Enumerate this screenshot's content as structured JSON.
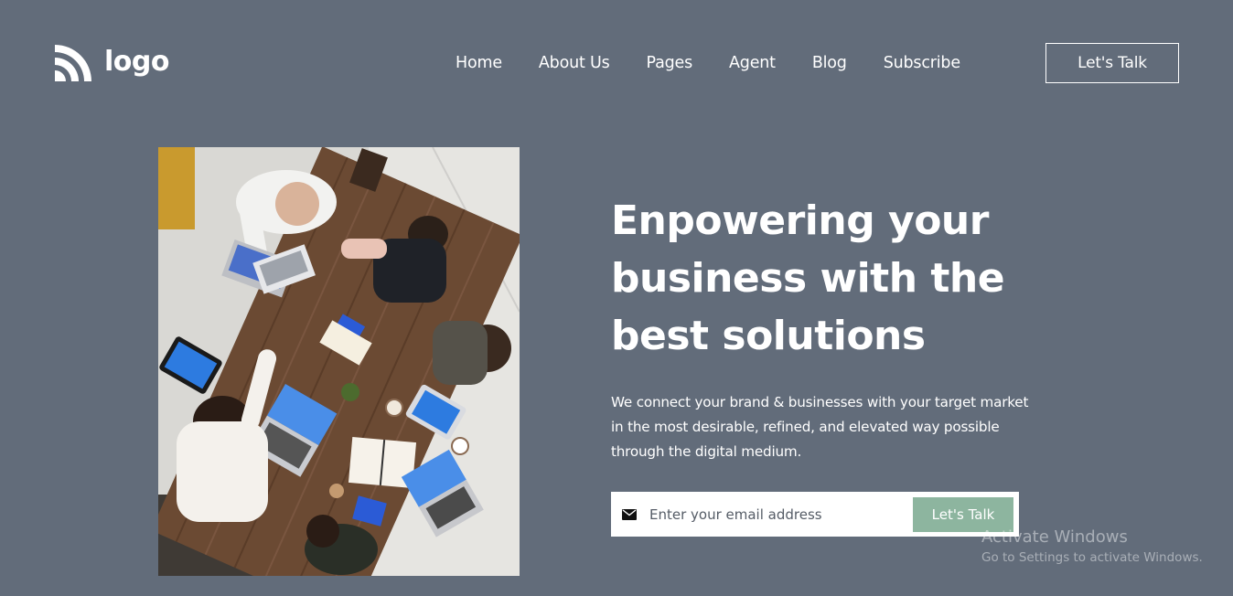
{
  "header": {
    "logo_text": "logo",
    "logo_icon": "wifi-rss-logo-icon",
    "nav": [
      "Home",
      "About Us",
      "Pages",
      "Agent",
      "Blog",
      "Subscribe"
    ],
    "cta_label": "Let's Talk"
  },
  "hero": {
    "image_subject": "team-meeting-photo",
    "title_lines": [
      "Enpowering your",
      "business with the",
      "best solutions"
    ],
    "description_lines": [
      "We connect your brand & businesses with your target market",
      "in the most desirable, refined, and elevated way possible",
      "through the digital medium."
    ]
  },
  "subscribe": {
    "icon": "mail-icon",
    "placeholder": "Enter your email address",
    "button_label": "Let's Talk"
  },
  "watermark": {
    "title": "Activate Windows",
    "subtitle": "Go to Settings to activate Windows."
  },
  "colors": {
    "background": "#626c7a",
    "accent_button": "#8db59f",
    "text": "#ffffff"
  }
}
